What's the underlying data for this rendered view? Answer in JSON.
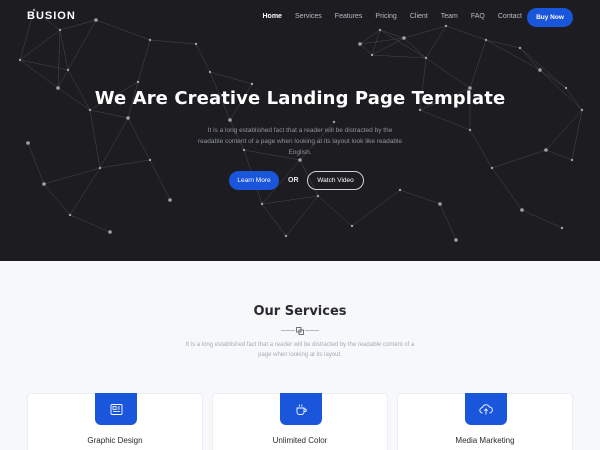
{
  "brand": "BUSION",
  "nav": {
    "items": [
      {
        "label": "Home",
        "active": true
      },
      {
        "label": "Services"
      },
      {
        "label": "Features"
      },
      {
        "label": "Pricing"
      },
      {
        "label": "Client"
      },
      {
        "label": "Team"
      },
      {
        "label": "FAQ"
      },
      {
        "label": "Contact"
      }
    ],
    "cta": "Buy Now"
  },
  "hero": {
    "title": "We Are Creative Landing Page Template",
    "text": "It is a long established fact that a reader will be distracted by the readable content of a page when looking at its layout look like readable English.",
    "primary_cta": "Learn More",
    "or": "OR",
    "secondary_cta": "Watch Video"
  },
  "services": {
    "title": "Our Services",
    "subtitle": "It is a long established fact that a reader will be distracted by the readable content of a page when looking at its layout.",
    "cards": [
      {
        "label": "Graphic Design",
        "icon": "newspaper-icon"
      },
      {
        "label": "Unlimited Color",
        "icon": "coffee-cup-icon"
      },
      {
        "label": "Media Marketing",
        "icon": "cloud-upload-icon"
      }
    ]
  },
  "colors": {
    "accent": "#1a56db",
    "hero_bg": "#1d1d21",
    "page_bg": "#f7f8fb"
  }
}
